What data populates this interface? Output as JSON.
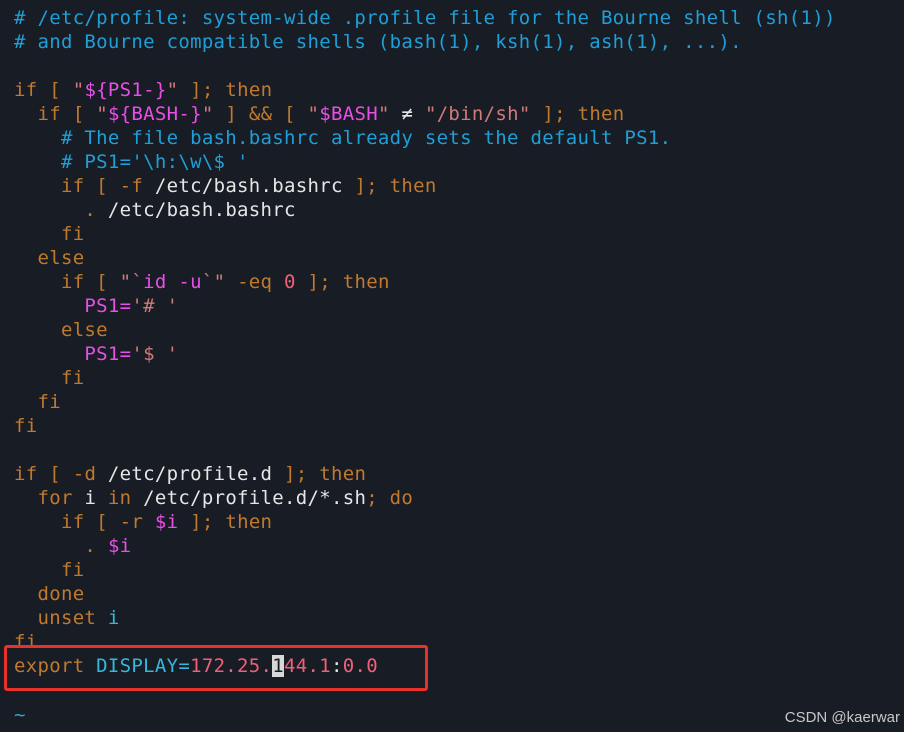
{
  "colors": {
    "background": "#181c24",
    "comment": "#1e9fd8",
    "keyword": "#c07a2e",
    "string_quote": "#d07a7a",
    "variable": "#e84fe8",
    "text": "#e6e6e6",
    "number": "#f0607a",
    "builtin": "#35b8e0",
    "operator": "#e6e6e6",
    "tilde": "#36a0d8",
    "highlight_border": "#e8312a"
  },
  "lines": [
    {
      "tokens": [
        {
          "text": "# /etc/profile: system-wide .profile file for the Bourne shell (sh(1))",
          "kind": "comment"
        }
      ]
    },
    {
      "tokens": [
        {
          "text": "# and Bourne compatible shells (bash(1), ksh(1), ash(1), ...).",
          "kind": "comment"
        }
      ]
    },
    {
      "tokens": []
    },
    {
      "tokens": [
        {
          "text": "if",
          "kind": "keyword"
        },
        {
          "text": " [ ",
          "kind": "keyword"
        },
        {
          "text": "\"",
          "kind": "string_quote"
        },
        {
          "text": "${PS1-}",
          "kind": "variable"
        },
        {
          "text": "\"",
          "kind": "string_quote"
        },
        {
          "text": " ]; ",
          "kind": "keyword"
        },
        {
          "text": "then",
          "kind": "keyword"
        }
      ]
    },
    {
      "tokens": [
        {
          "text": "  if",
          "kind": "keyword"
        },
        {
          "text": " [ ",
          "kind": "keyword"
        },
        {
          "text": "\"",
          "kind": "string_quote"
        },
        {
          "text": "${BASH-}",
          "kind": "variable"
        },
        {
          "text": "\"",
          "kind": "string_quote"
        },
        {
          "text": " ] ",
          "kind": "keyword"
        },
        {
          "text": "&&",
          "kind": "keyword"
        },
        {
          "text": " [ ",
          "kind": "keyword"
        },
        {
          "text": "\"",
          "kind": "string_quote"
        },
        {
          "text": "$BASH",
          "kind": "variable"
        },
        {
          "text": "\"",
          "kind": "string_quote"
        },
        {
          "text": " ≠ ",
          "kind": "text"
        },
        {
          "text": "\"/bin/sh\"",
          "kind": "string_quote"
        },
        {
          "text": " ]; ",
          "kind": "keyword"
        },
        {
          "text": "then",
          "kind": "keyword"
        }
      ]
    },
    {
      "tokens": [
        {
          "text": "    # The file bash.bashrc already sets the default PS1.",
          "kind": "comment"
        }
      ]
    },
    {
      "tokens": [
        {
          "text": "    # PS1='\\h:\\w\\$ '",
          "kind": "comment"
        }
      ]
    },
    {
      "tokens": [
        {
          "text": "    if",
          "kind": "keyword"
        },
        {
          "text": " [ ",
          "kind": "keyword"
        },
        {
          "text": "-f",
          "kind": "keyword"
        },
        {
          "text": " /etc/bash.bashrc",
          "kind": "text"
        },
        {
          "text": " ]; ",
          "kind": "keyword"
        },
        {
          "text": "then",
          "kind": "keyword"
        }
      ]
    },
    {
      "tokens": [
        {
          "text": "      .",
          "kind": "keyword"
        },
        {
          "text": " /etc/bash.bashrc",
          "kind": "text"
        }
      ]
    },
    {
      "tokens": [
        {
          "text": "    fi",
          "kind": "keyword"
        }
      ]
    },
    {
      "tokens": [
        {
          "text": "  else",
          "kind": "keyword"
        }
      ]
    },
    {
      "tokens": [
        {
          "text": "    if",
          "kind": "keyword"
        },
        {
          "text": " [ ",
          "kind": "keyword"
        },
        {
          "text": "\"`",
          "kind": "string_quote"
        },
        {
          "text": "id -u",
          "kind": "variable"
        },
        {
          "text": "`\"",
          "kind": "string_quote"
        },
        {
          "text": " -eq ",
          "kind": "keyword"
        },
        {
          "text": "0",
          "kind": "number"
        },
        {
          "text": " ]; ",
          "kind": "keyword"
        },
        {
          "text": "then",
          "kind": "keyword"
        }
      ]
    },
    {
      "tokens": [
        {
          "text": "      PS1=",
          "kind": "variable"
        },
        {
          "text": "'# '",
          "kind": "string_quote"
        }
      ]
    },
    {
      "tokens": [
        {
          "text": "    else",
          "kind": "keyword"
        }
      ]
    },
    {
      "tokens": [
        {
          "text": "      PS1=",
          "kind": "variable"
        },
        {
          "text": "'$ '",
          "kind": "string_quote"
        }
      ]
    },
    {
      "tokens": [
        {
          "text": "    fi",
          "kind": "keyword"
        }
      ]
    },
    {
      "tokens": [
        {
          "text": "  fi",
          "kind": "keyword"
        }
      ]
    },
    {
      "tokens": [
        {
          "text": "fi",
          "kind": "keyword"
        }
      ]
    },
    {
      "tokens": []
    },
    {
      "tokens": [
        {
          "text": "if",
          "kind": "keyword"
        },
        {
          "text": " [ ",
          "kind": "keyword"
        },
        {
          "text": "-d",
          "kind": "keyword"
        },
        {
          "text": " /etc/profile.d",
          "kind": "text"
        },
        {
          "text": " ]; ",
          "kind": "keyword"
        },
        {
          "text": "then",
          "kind": "keyword"
        }
      ]
    },
    {
      "tokens": [
        {
          "text": "  for",
          "kind": "keyword"
        },
        {
          "text": " i ",
          "kind": "text"
        },
        {
          "text": "in",
          "kind": "keyword"
        },
        {
          "text": " /etc/profile.d/*.sh",
          "kind": "text"
        },
        {
          "text": "; ",
          "kind": "keyword"
        },
        {
          "text": "do",
          "kind": "keyword"
        }
      ]
    },
    {
      "tokens": [
        {
          "text": "    if",
          "kind": "keyword"
        },
        {
          "text": " [ ",
          "kind": "keyword"
        },
        {
          "text": "-r",
          "kind": "keyword"
        },
        {
          "text": " ",
          "kind": "text"
        },
        {
          "text": "$i",
          "kind": "variable"
        },
        {
          "text": " ]; ",
          "kind": "keyword"
        },
        {
          "text": "then",
          "kind": "keyword"
        }
      ]
    },
    {
      "tokens": [
        {
          "text": "      .",
          "kind": "keyword"
        },
        {
          "text": " ",
          "kind": "text"
        },
        {
          "text": "$i",
          "kind": "variable"
        }
      ]
    },
    {
      "tokens": [
        {
          "text": "    fi",
          "kind": "keyword"
        }
      ]
    },
    {
      "tokens": [
        {
          "text": "  done",
          "kind": "keyword"
        }
      ]
    },
    {
      "tokens": [
        {
          "text": "  unset",
          "kind": "keyword"
        },
        {
          "text": " i",
          "kind": "builtin"
        }
      ]
    },
    {
      "tokens": [
        {
          "text": "fi",
          "kind": "keyword"
        }
      ]
    },
    {
      "tokens": [
        {
          "text": "export",
          "kind": "keyword"
        },
        {
          "text": " DISPLAY=",
          "kind": "builtin"
        },
        {
          "text": "172.25.",
          "kind": "number"
        },
        {
          "text": "1",
          "kind": "cursor"
        },
        {
          "text": "44.1",
          "kind": "number"
        },
        {
          "text": ":",
          "kind": "text"
        },
        {
          "text": "0.0",
          "kind": "number"
        }
      ]
    },
    {
      "tokens": [
        {
          "text": "~",
          "kind": "tilde"
        }
      ]
    },
    {
      "tokens": [
        {
          "text": "~",
          "kind": "tilde"
        }
      ]
    }
  ],
  "watermark": "CSDN @kaerwar"
}
